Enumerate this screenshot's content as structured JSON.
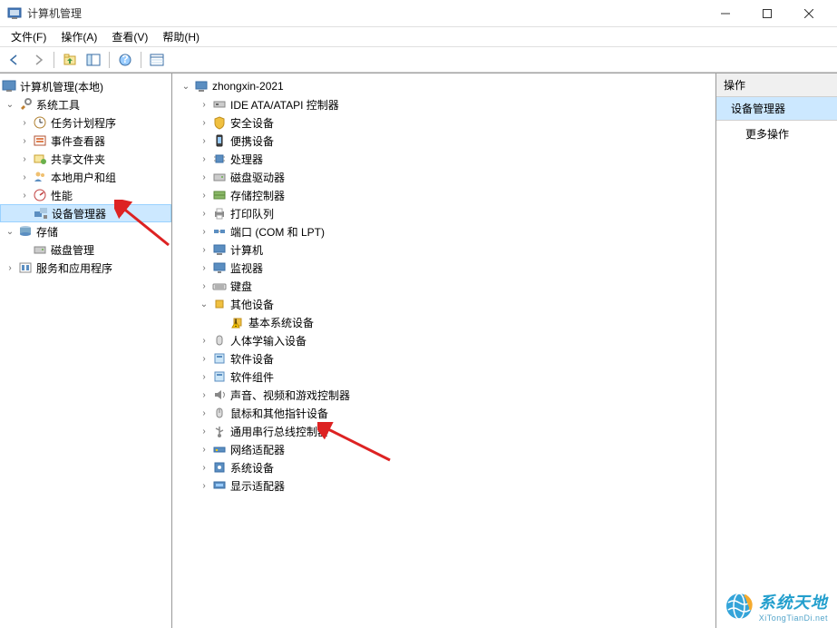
{
  "window": {
    "title": "计算机管理"
  },
  "menu": {
    "file": "文件(F)",
    "action": "操作(A)",
    "view": "查看(V)",
    "help": "帮助(H)"
  },
  "left_tree": {
    "root": "计算机管理(本地)",
    "sys_tools": "系统工具",
    "task_sched": "任务计划程序",
    "event_viewer": "事件查看器",
    "shared_folders": "共享文件夹",
    "local_users": "本地用户和组",
    "performance": "性能",
    "device_manager": "设备管理器",
    "storage": "存储",
    "disk_mgmt": "磁盘管理",
    "services_apps": "服务和应用程序"
  },
  "device_tree": {
    "root": "zhongxin-2021",
    "ide": "IDE ATA/ATAPI 控制器",
    "security": "安全设备",
    "portable": "便携设备",
    "processors": "处理器",
    "disk_drives": "磁盘驱动器",
    "storage_ctrl": "存储控制器",
    "print_queues": "打印队列",
    "ports": "端口 (COM 和 LPT)",
    "computer": "计算机",
    "monitors": "监视器",
    "keyboards": "键盘",
    "other": "其他设备",
    "other_child": "基本系统设备",
    "hid": "人体学输入设备",
    "software_dev": "软件设备",
    "software_comp": "软件组件",
    "sound": "声音、视频和游戏控制器",
    "mice": "鼠标和其他指针设备",
    "usb": "通用串行总线控制器",
    "network": "网络适配器",
    "system": "系统设备",
    "display": "显示适配器"
  },
  "actions_panel": {
    "header": "操作",
    "selected": "设备管理器",
    "more": "更多操作"
  },
  "watermark": {
    "main": "系统天地",
    "sub": "XiTongTianDi.net"
  }
}
